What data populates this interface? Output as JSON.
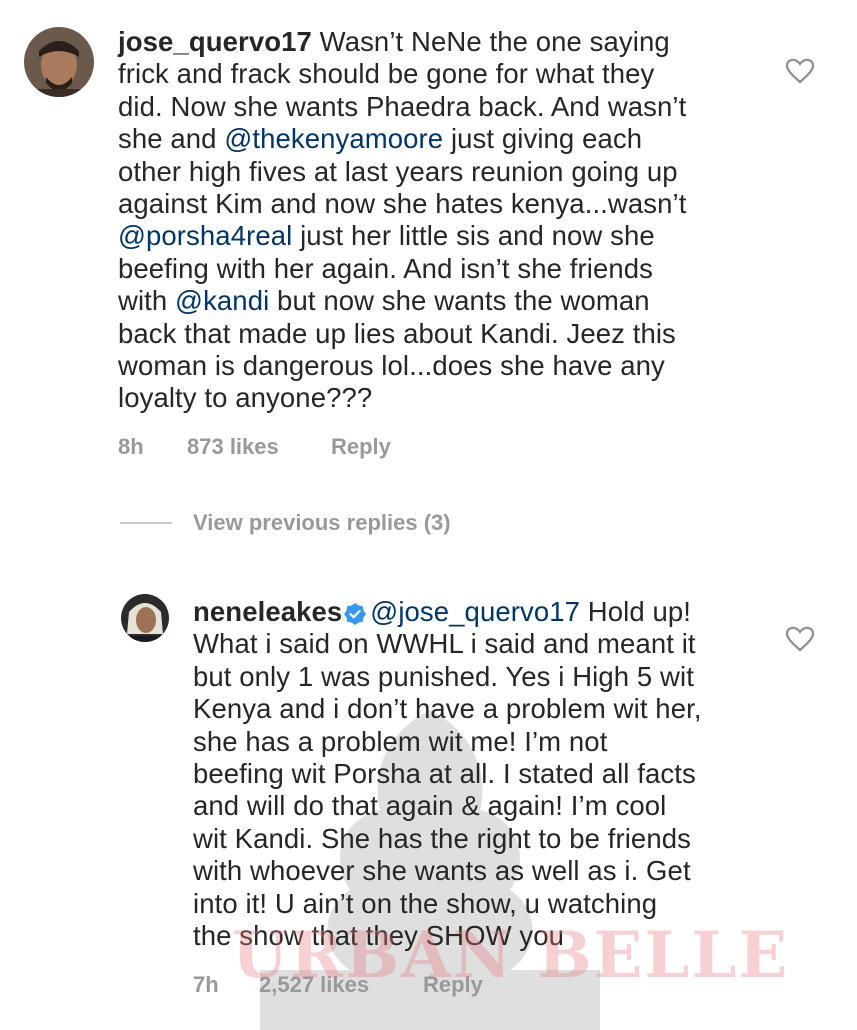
{
  "comment1": {
    "username": "jose_quervo17",
    "lines": [
      [
        {
          "t": "Wasn’t NeNe the one saying",
          "m": false
        }
      ],
      [
        {
          "t": "frick and frack should be gone for what they",
          "m": false
        }
      ],
      [
        {
          "t": "did. Now she wants Phaedra back. And wasn’t",
          "m": false
        }
      ],
      [
        {
          "t": "she and ",
          "m": false
        },
        {
          "t": "@thekenyamoore",
          "m": true
        },
        {
          "t": " just giving each",
          "m": false
        }
      ],
      [
        {
          "t": "other high fives at last years reunion going up",
          "m": false
        }
      ],
      [
        {
          "t": "against Kim and now she hates kenya...wasn’t",
          "m": false
        }
      ],
      [
        {
          "t": "@porsha4real",
          "m": true
        },
        {
          "t": " just her little sis and now she",
          "m": false
        }
      ],
      [
        {
          "t": "beefing with her again. And isn’t she friends",
          "m": false
        }
      ],
      [
        {
          "t": "with ",
          "m": false
        },
        {
          "t": "@kandi",
          "m": true
        },
        {
          "t": " but now she wants the woman",
          "m": false
        }
      ],
      [
        {
          "t": "back that made up lies about Kandi. Jeez this",
          "m": false
        }
      ],
      [
        {
          "t": "woman is dangerous lol...does she have any",
          "m": false
        }
      ],
      [
        {
          "t": "loyalty to anyone???",
          "m": false
        }
      ]
    ],
    "time": "8h",
    "likes": "873 likes",
    "reply_label": "Reply"
  },
  "view_previous": "View previous replies (3)",
  "comment2": {
    "username": "neneleakes",
    "lines": [
      [
        {
          "t": "@jose_quervo17",
          "m": true
        },
        {
          "t": " Hold up!",
          "m": false
        }
      ],
      [
        {
          "t": "What i said on WWHL i said and meant it",
          "m": false
        }
      ],
      [
        {
          "t": "but only 1 was punished. Yes i High 5 wit",
          "m": false
        }
      ],
      [
        {
          "t": "Kenya and i don’t have a problem wit her,",
          "m": false
        }
      ],
      [
        {
          "t": "she has a problem wit me! I’m not",
          "m": false
        }
      ],
      [
        {
          "t": "beefing wit Porsha at all. I stated all facts",
          "m": false
        }
      ],
      [
        {
          "t": "and will do that again & again! I’m cool",
          "m": false
        }
      ],
      [
        {
          "t": "wit Kandi. She has the right to be friends",
          "m": false
        }
      ],
      [
        {
          "t": "with whoever she wants as well as i. Get",
          "m": false
        }
      ],
      [
        {
          "t": "into it! U ain’t on the show, u watching",
          "m": false
        }
      ],
      [
        {
          "t": "the show that they SHOW you",
          "m": false
        }
      ]
    ],
    "time": "7h",
    "likes": "2,527 likes",
    "reply_label": "Reply"
  },
  "watermark": "URBAN BELLE",
  "colors": {
    "text": "#262626",
    "mention": "#003569",
    "meta": "#999999",
    "verified": "#3897f0"
  },
  "icons": {
    "like": "heart-outline-icon",
    "verified": "verified-badge-icon"
  }
}
